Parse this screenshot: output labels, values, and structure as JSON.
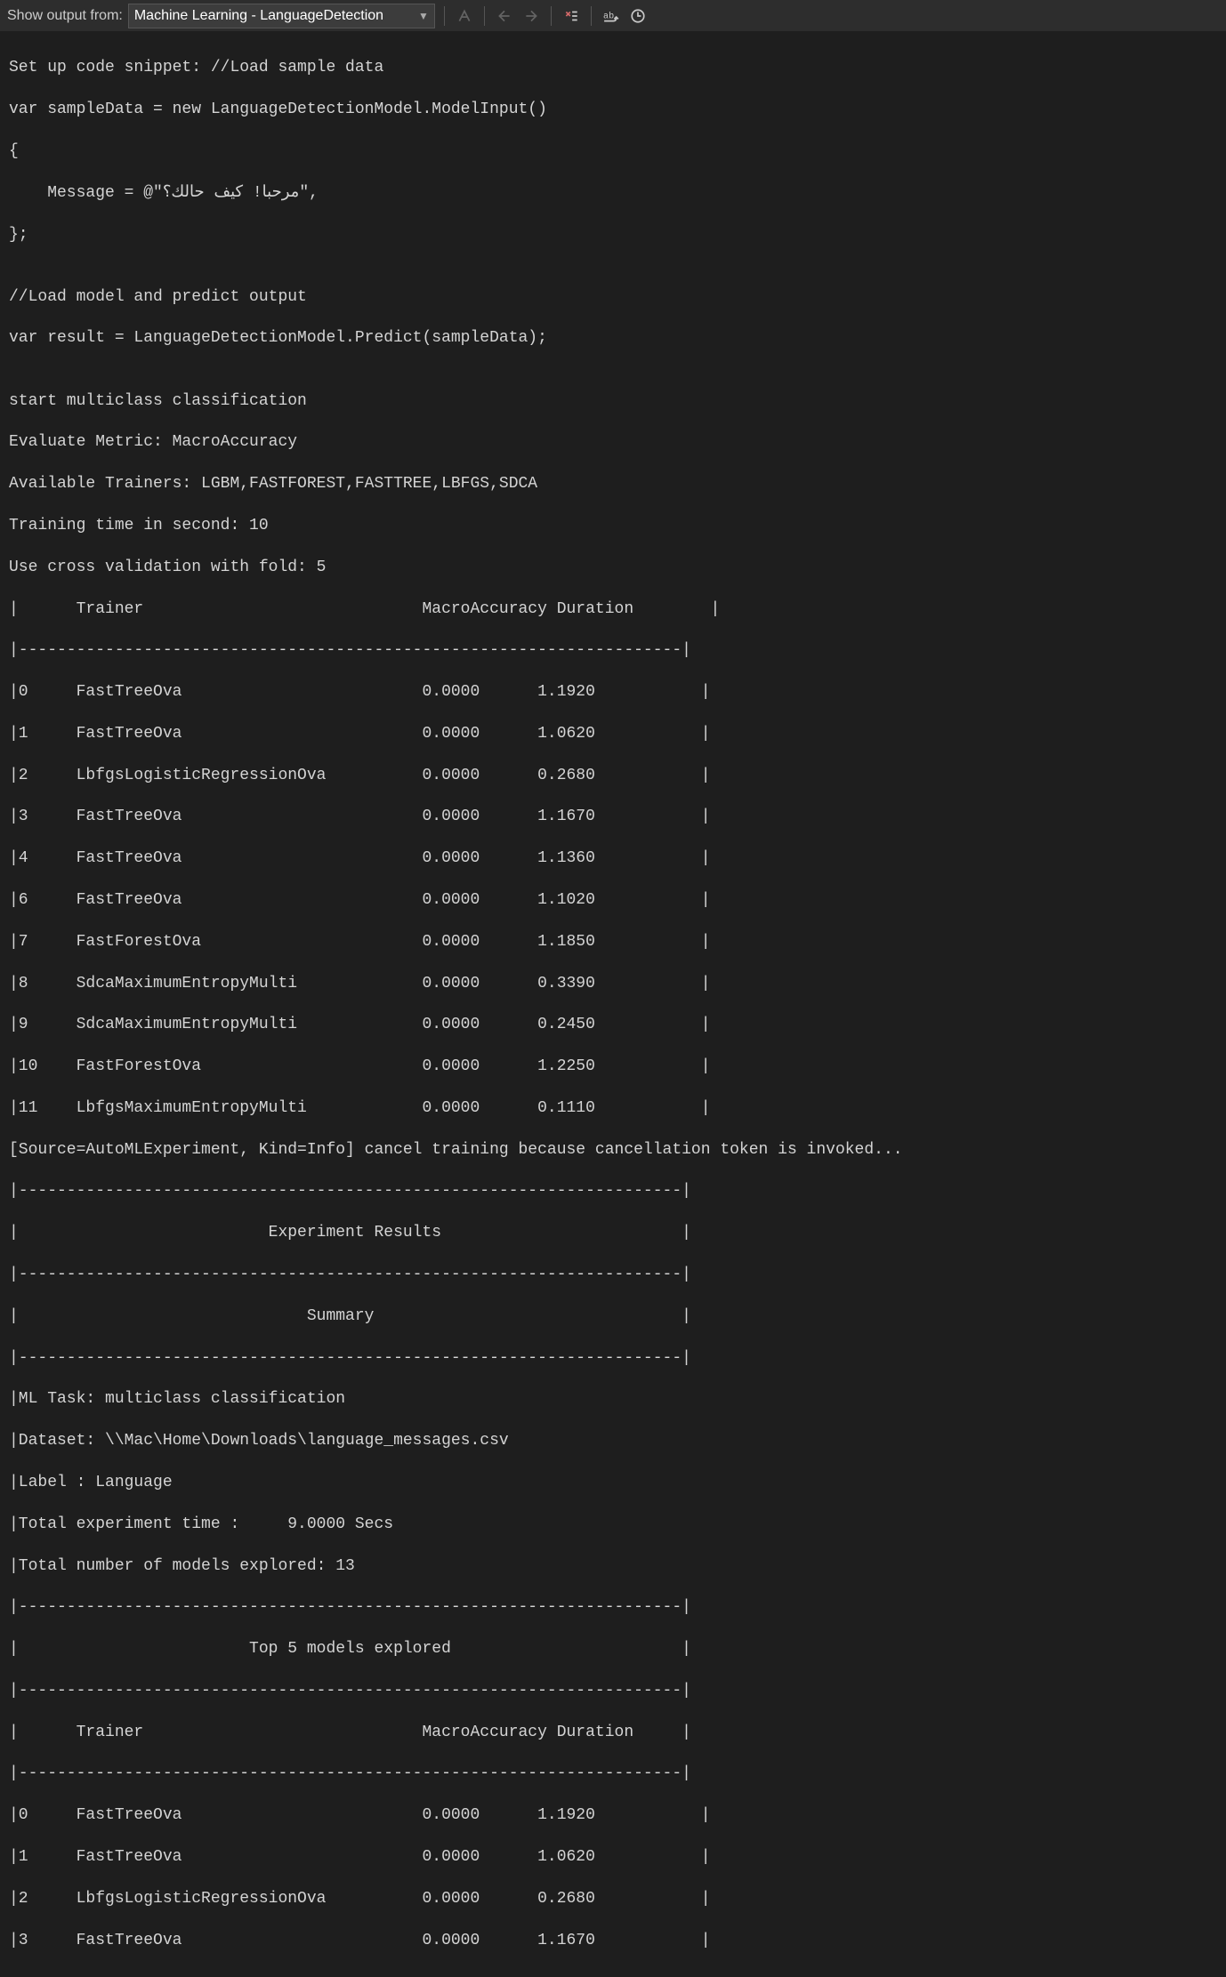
{
  "toolbar": {
    "label": "Show output from:",
    "dropdown_value": "Machine Learning - LanguageDetection"
  },
  "code": {
    "line1": "Set up code snippet: //Load sample data",
    "line2": "var sampleData = new LanguageDetectionModel.ModelInput()",
    "line3": "{",
    "line4": "    Message = @\"‫مرحبا! كيف حالك؟‬\",",
    "line5": "};",
    "line6": "",
    "line7": "//Load model and predict output",
    "line8": "var result = LanguageDetectionModel.Predict(sampleData);"
  },
  "training": {
    "start": "start multiclass classification",
    "metric": "Evaluate Metric: MacroAccuracy",
    "trainers": "Available Trainers: LGBM,FASTFOREST,FASTTREE,LBFGS,SDCA",
    "time": "Training time in second: 10",
    "cv": "Use cross validation with fold: 5"
  },
  "table_header": "|      Trainer                             MacroAccuracy Duration        |",
  "hr": "|---------------------------------------------------------------------|",
  "rows": [
    "|0     FastTreeOva                         0.0000      1.1920           |",
    "|1     FastTreeOva                         0.0000      1.0620           |",
    "|2     LbfgsLogisticRegressionOva          0.0000      0.2680           |",
    "|3     FastTreeOva                         0.0000      1.1670           |",
    "|4     FastTreeOva                         0.0000      1.1360           |",
    "|6     FastTreeOva                         0.0000      1.1020           |",
    "|7     FastForestOva                       0.0000      1.1850           |",
    "|8     SdcaMaximumEntropyMulti             0.0000      0.3390           |",
    "|9     SdcaMaximumEntropyMulti             0.0000      0.2450           |",
    "|10    FastForestOva                       0.0000      1.2250           |",
    "|11    LbfgsMaximumEntropyMulti            0.0000      0.1110           |"
  ],
  "cancel_msg": "[Source=AutoMLExperiment, Kind=Info] cancel training because cancellation token is invoked...",
  "exp_results_title": "|                          Experiment Results                         |",
  "summary_title": "|                              Summary                                |",
  "summary": {
    "task": "|ML Task: multiclass classification                                   ",
    "dataset": "|Dataset: \\\\Mac\\Home\\Downloads\\language_messages.csv                  ",
    "label": "|Label : Language                                                     ",
    "time": "|Total experiment time :     9.0000 Secs                              ",
    "models": "|Total number of models explored: 13                                  "
  },
  "top5_title": "|                        Top 5 models explored                        |",
  "top5_header": "|      Trainer                             MacroAccuracy Duration     |",
  "top5_rows": [
    "|0     FastTreeOva                         0.0000      1.1920           |",
    "|1     FastTreeOva                         0.0000      1.0620           |",
    "|2     LbfgsLogisticRegressionOva          0.0000      0.2680           |",
    "|3     FastTreeOva                         0.0000      1.1670           |"
  ]
}
